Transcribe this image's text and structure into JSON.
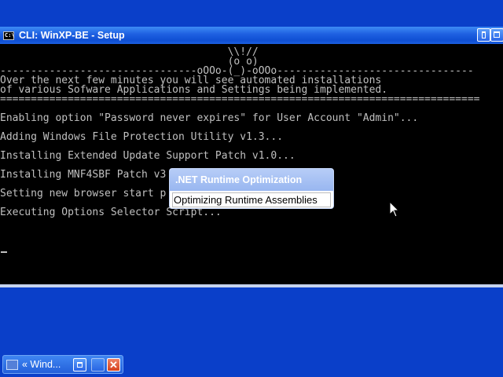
{
  "window": {
    "title": "CLI: WinXP-BE - Setup",
    "icon": "console-icon"
  },
  "console": {
    "lines": [
      "                                     \\\\!//",
      "                                     (o o)",
      "--------------------------------oOOo-(_)-oOOo--------------------------------",
      "Over the next few minutes you will see automated installations",
      "of various Sofware Applications and Settings being implemented.",
      "==============================================================================",
      "",
      "Enabling option \"Password never expires\" for User Account \"Admin\"...",
      "",
      "Adding Windows File Protection Utility v1.3...",
      "",
      "Installing Extended Update Support Patch v1.0...",
      "",
      "Installing MNF4SBF Patch v3",
      "",
      "Setting new browser start p",
      "",
      "Executing Options Selector Script..."
    ]
  },
  "popup": {
    "title": ".NET Runtime Optimization",
    "message": "Optimizing Runtime Assemblies"
  },
  "taskbar": {
    "item_label": "« Wind...",
    "close_glyph": "✕"
  },
  "colors": {
    "desktop": "#0a3fc9",
    "titlebar": "#1d5ee0",
    "console_bg": "#000000",
    "console_text": "#c0c0c0"
  }
}
